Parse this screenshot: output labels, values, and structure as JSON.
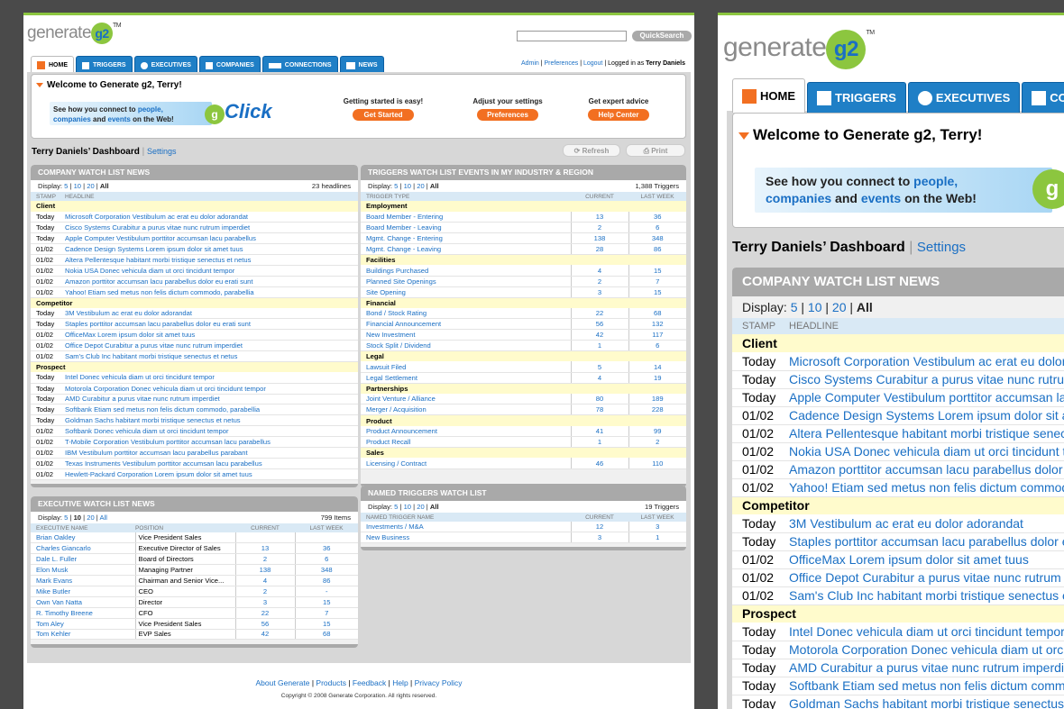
{
  "brand": {
    "logo_text": "generate",
    "logo_mark": "g2",
    "tm": "TM",
    "accent": "#8cc63f",
    "primary": "#1f7fc6",
    "orange": "#f26f21"
  },
  "header": {
    "quicksearch_label": "QuickSearch",
    "search_value": "",
    "admin_links": [
      "Admin",
      "Preferences",
      "Logout"
    ],
    "logged_in_text": "Logged in as",
    "user": "Terry Daniels"
  },
  "tabs": [
    {
      "label": "HOME",
      "icon": "home-icon"
    },
    {
      "label": "TRIGGERS",
      "icon": "flag-icon"
    },
    {
      "label": "EXECUTIVES",
      "icon": "people-icon"
    },
    {
      "label": "COMPANIES",
      "icon": "building-icon"
    },
    {
      "label": "CONNECTIONS",
      "icon": "connections-icon"
    },
    {
      "label": "NEWS",
      "icon": "news-icon"
    }
  ],
  "welcome": {
    "title": "Welcome to Generate g2, Terry!",
    "banner_pre": "See how you connect to",
    "banner_people": "people,",
    "banner_companies": "companies",
    "banner_and": "and",
    "banner_events": "events",
    "banner_post": "on the Web!",
    "click_logo": "Click",
    "ctas": [
      {
        "heading": "Getting started is easy!",
        "button": "Get Started"
      },
      {
        "heading": "Adjust your settings",
        "button": "Preferences"
      },
      {
        "heading": "Get expert advice",
        "button": "Help Center"
      }
    ]
  },
  "dashboard": {
    "title": "Terry Daniels’ Dashboard",
    "settings": "Settings",
    "refresh": "Refresh",
    "print": "Print"
  },
  "display": {
    "label": "Display:",
    "options": [
      "5",
      "10",
      "20",
      "All"
    ]
  },
  "company_watch": {
    "title": "COMPANY WATCH LIST NEWS",
    "count": "23 headlines",
    "col_stamp": "STAMP",
    "col_headline": "HEADLINE",
    "groups": [
      {
        "name": "Client",
        "rows": [
          [
            "Today",
            "Microsoft Corporation Vestibulum ac erat eu dolor adorandat"
          ],
          [
            "Today",
            "Cisco Systems Curabitur a purus vitae nunc rutrum imperdiet"
          ],
          [
            "Today",
            "Apple Computer Vestibulum porttitor accumsan lacu parabellus"
          ],
          [
            "01/02",
            "Cadence Design Systems Lorem ipsum dolor sit amet tuus"
          ],
          [
            "01/02",
            "Altera Pellentesque habitant morbi tristique senectus et netus"
          ],
          [
            "01/02",
            "Nokia USA Donec vehicula diam ut orci tincidunt tempor"
          ],
          [
            "01/02",
            "Amazon porttitor accumsan lacu parabellus dolor eu erati sunt"
          ],
          [
            "01/02",
            "Yahoo! Etiam sed metus non felis dictum commodo, parabellia"
          ]
        ]
      },
      {
        "name": "Competitor",
        "rows": [
          [
            "Today",
            "3M Vestibulum ac erat eu dolor adorandat"
          ],
          [
            "Today",
            "Staples porttitor accumsan lacu parabellus dolor eu erati sunt"
          ],
          [
            "01/02",
            "OfficeMax Lorem ipsum dolor sit amet tuus"
          ],
          [
            "01/02",
            "Office Depot Curabitur a purus vitae nunc rutrum imperdiet"
          ],
          [
            "01/02",
            "Sam's Club Inc habitant morbi tristique senectus et netus"
          ]
        ]
      },
      {
        "name": "Prospect",
        "rows": [
          [
            "Today",
            "Intel Donec vehicula diam ut orci tincidunt tempor"
          ],
          [
            "Today",
            "Motorola Corporation Donec vehicula diam ut orci tincidunt tempor"
          ],
          [
            "Today",
            "AMD Curabitur a purus vitae nunc rutrum imperdiet"
          ],
          [
            "Today",
            "Softbank Etiam sed metus non felis dictum commodo, parabellia"
          ],
          [
            "Today",
            "Goldman Sachs habitant morbi tristique senectus et netus"
          ],
          [
            "01/02",
            "Softbank Donec vehicula diam ut orci tincidunt tempor"
          ],
          [
            "01/02",
            "T-Mobile Corporation Vestibulum porttitor accumsan lacu parabellus"
          ],
          [
            "01/02",
            "IBM Vestibulum porttitor accumsan lacu parabellus parabant"
          ],
          [
            "01/02",
            "Texas Instruments Vestibulum porttitor accumsan lacu parabellus"
          ],
          [
            "01/02",
            "Hewlett-Packard Corporation Lorem ipsum dolor sit amet tuus"
          ]
        ]
      }
    ]
  },
  "triggers_watch": {
    "title": "TRIGGERS WATCH LIST EVENTS IN MY INDUSTRY & REGION",
    "count": "1,388 Triggers",
    "col_type": "TRIGGER TYPE",
    "col_current": "CURRENT",
    "col_last": "LAST WEEK",
    "groups": [
      {
        "name": "Employment",
        "rows": [
          [
            "Board Member - Entering",
            "13",
            "36"
          ],
          [
            "Board Member - Leaving",
            "2",
            "6"
          ],
          [
            "Mgmt. Change - Entering",
            "138",
            "348"
          ],
          [
            "Mgmt. Change - Leaving",
            "28",
            "86"
          ]
        ]
      },
      {
        "name": "Facilities",
        "rows": [
          [
            "Buildings Purchased",
            "4",
            "15"
          ],
          [
            "Planned Site Openings",
            "2",
            "7"
          ],
          [
            "Site Opening",
            "3",
            "15"
          ]
        ]
      },
      {
        "name": "Financial",
        "rows": [
          [
            "Bond / Stock Rating",
            "22",
            "68"
          ],
          [
            "Financial Announcement",
            "56",
            "132"
          ],
          [
            "New Investment",
            "42",
            "117"
          ],
          [
            "Stock Split / Dividend",
            "1",
            "6"
          ]
        ]
      },
      {
        "name": "Legal",
        "rows": [
          [
            "Lawsuit Filed",
            "5",
            "14"
          ],
          [
            "Legal Settlement",
            "4",
            "19"
          ]
        ]
      },
      {
        "name": "Partnerships",
        "rows": [
          [
            "Joint Venture / Alliance",
            "80",
            "189"
          ],
          [
            "Merger / Acquisition",
            "78",
            "228"
          ]
        ]
      },
      {
        "name": "Product",
        "rows": [
          [
            "Product Announcement",
            "41",
            "99"
          ],
          [
            "Product Recall",
            "1",
            "2"
          ]
        ]
      },
      {
        "name": "Sales",
        "rows": [
          [
            "Licensing / Contract",
            "46",
            "110"
          ]
        ]
      }
    ]
  },
  "named_triggers": {
    "title": "NAMED TRIGGERS WATCH LIST",
    "count": "19 Triggers",
    "col_name": "NAMED TRIGGER NAME",
    "col_current": "CURRENT",
    "col_last": "LAST WEEK",
    "rows": [
      [
        "Investments / M&A",
        "12",
        "3"
      ],
      [
        "New Business",
        "3",
        "1"
      ]
    ]
  },
  "exec_watch": {
    "title": "EXECUTIVE WATCH LIST NEWS",
    "count": "799 Items",
    "col_name": "EXECUTIVE NAME",
    "col_position": "POSITION",
    "col_current": "CURRENT",
    "col_last": "LAST WEEK",
    "rows": [
      [
        "Brian Oakley",
        "Vice President Sales",
        "",
        ""
      ],
      [
        "Charles Giancarlo",
        "Executive Director of Sales",
        "13",
        "36"
      ],
      [
        "Dale L. Fuller",
        "Board of Directors",
        "2",
        "6"
      ],
      [
        "Elon Musk",
        "Managing Partner",
        "138",
        "348"
      ],
      [
        "Mark Evans",
        "Chairman and Senior Vice...",
        "4",
        "86"
      ],
      [
        "Mike Butler",
        "CEO",
        "2",
        "-"
      ],
      [
        "Own Van Natta",
        "Director",
        "3",
        "15"
      ],
      [
        "R. Timothy Breene",
        "CFO",
        "22",
        "7"
      ],
      [
        "Tom Aley",
        "Vice President Sales",
        "56",
        "15"
      ],
      [
        "Tom Kehler",
        "EVP Sales",
        "42",
        "68"
      ]
    ]
  },
  "footer": {
    "links": [
      "About Generate",
      "Products",
      "Feedback",
      "Help",
      "Privacy Policy"
    ],
    "copyright": "Copyright © 2008 Generate Corporation. All rights reserved."
  }
}
